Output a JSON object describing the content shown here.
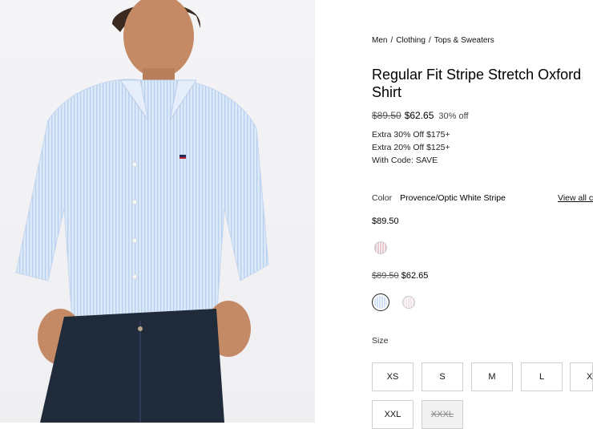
{
  "breadcrumb": [
    "Men",
    "Clothing",
    "Tops & Sweaters"
  ],
  "product": {
    "title": "Regular Fit Stripe Stretch Oxford Shirt",
    "original_price": "$89.50",
    "sale_price": "$62.65",
    "discount": "30% off"
  },
  "promotions": [
    "Extra 30% Off $175+",
    "Extra 20% Off $125+",
    "With Code: SAVE"
  ],
  "color": {
    "label": "Color",
    "selected_name": "Provence/Optic White Stripe",
    "view_all": "View all c"
  },
  "swatch_groups": [
    {
      "price": "$89.50",
      "swatches": [
        {
          "name": "red-stripe",
          "color": "#e7c9cf"
        }
      ]
    },
    {
      "original_price": "$89.50",
      "sale_price": "$62.65",
      "swatches": [
        {
          "name": "blue-stripe",
          "color": "#cfe0f6",
          "selected": true
        },
        {
          "name": "pink-stripe",
          "color": "#f3e6ea"
        }
      ]
    }
  ],
  "size": {
    "label": "Size",
    "options": [
      {
        "label": "XS",
        "available": true
      },
      {
        "label": "S",
        "available": true
      },
      {
        "label": "M",
        "available": true
      },
      {
        "label": "L",
        "available": true
      },
      {
        "label": "XL",
        "available": true
      },
      {
        "label": "XXL",
        "available": true
      },
      {
        "label": "XXXL",
        "available": false
      }
    ]
  },
  "colors": {
    "shirt": "#cfe0f6",
    "jeans": "#1f2a3a",
    "skin": "#c48a66",
    "hair": "#3a2a20"
  }
}
